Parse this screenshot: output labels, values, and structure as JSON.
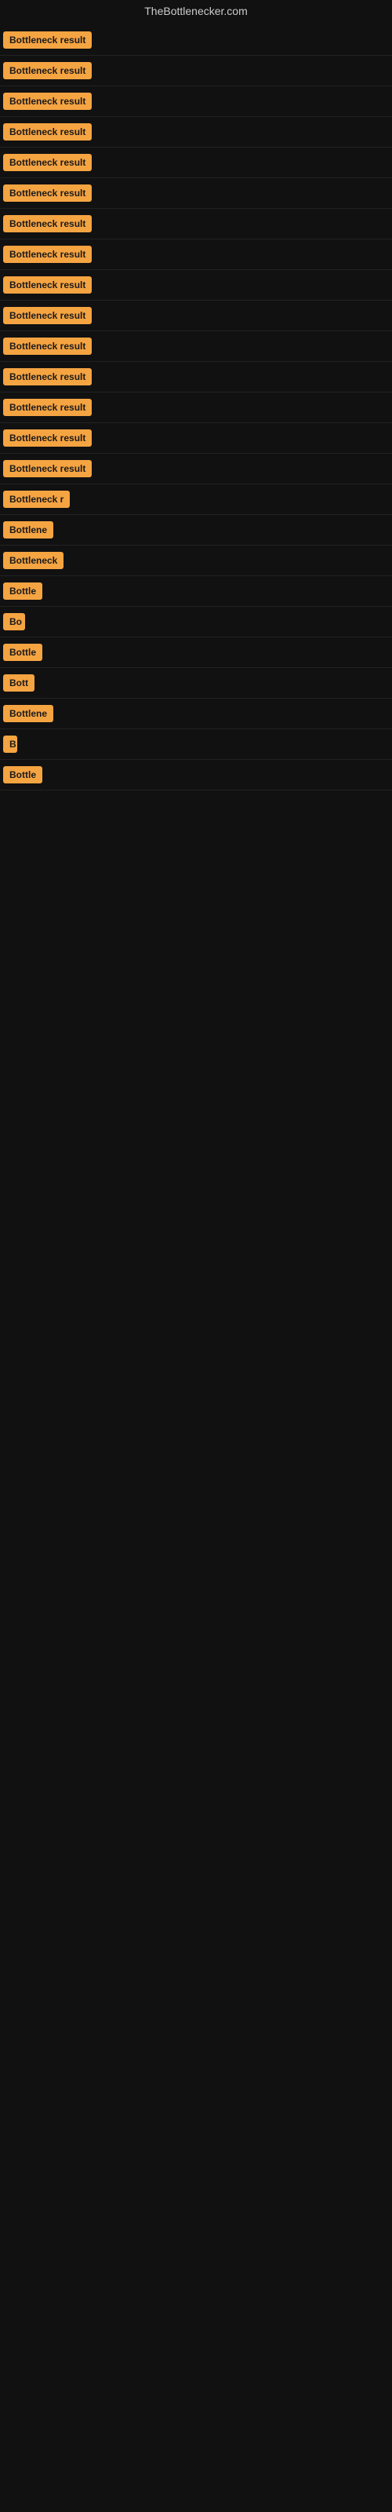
{
  "site": {
    "title": "TheBottlenecker.com"
  },
  "rows": [
    {
      "id": 1,
      "label": "Bottleneck result",
      "width": 130
    },
    {
      "id": 2,
      "label": "Bottleneck result",
      "width": 130
    },
    {
      "id": 3,
      "label": "Bottleneck result",
      "width": 130
    },
    {
      "id": 4,
      "label": "Bottleneck result",
      "width": 130
    },
    {
      "id": 5,
      "label": "Bottleneck result",
      "width": 130
    },
    {
      "id": 6,
      "label": "Bottleneck result",
      "width": 130
    },
    {
      "id": 7,
      "label": "Bottleneck result",
      "width": 130
    },
    {
      "id": 8,
      "label": "Bottleneck result",
      "width": 130
    },
    {
      "id": 9,
      "label": "Bottleneck result",
      "width": 130
    },
    {
      "id": 10,
      "label": "Bottleneck result",
      "width": 130
    },
    {
      "id": 11,
      "label": "Bottleneck result",
      "width": 130
    },
    {
      "id": 12,
      "label": "Bottleneck result",
      "width": 130
    },
    {
      "id": 13,
      "label": "Bottleneck result",
      "width": 130
    },
    {
      "id": 14,
      "label": "Bottleneck result",
      "width": 130
    },
    {
      "id": 15,
      "label": "Bottleneck result",
      "width": 130
    },
    {
      "id": 16,
      "label": "Bottleneck r",
      "width": 100
    },
    {
      "id": 17,
      "label": "Bottlene",
      "width": 75
    },
    {
      "id": 18,
      "label": "Bottleneck",
      "width": 82
    },
    {
      "id": 19,
      "label": "Bottle",
      "width": 55
    },
    {
      "id": 20,
      "label": "Bo",
      "width": 28
    },
    {
      "id": 21,
      "label": "Bottle",
      "width": 55
    },
    {
      "id": 22,
      "label": "Bott",
      "width": 42
    },
    {
      "id": 23,
      "label": "Bottlene",
      "width": 75
    },
    {
      "id": 24,
      "label": "B",
      "width": 18
    },
    {
      "id": 25,
      "label": "Bottle",
      "width": 55
    }
  ],
  "colors": {
    "badge_bg": "#f5a442",
    "badge_text": "#1a1a1a",
    "background": "#111111",
    "row_border": "#222222",
    "title_text": "#cccccc"
  }
}
